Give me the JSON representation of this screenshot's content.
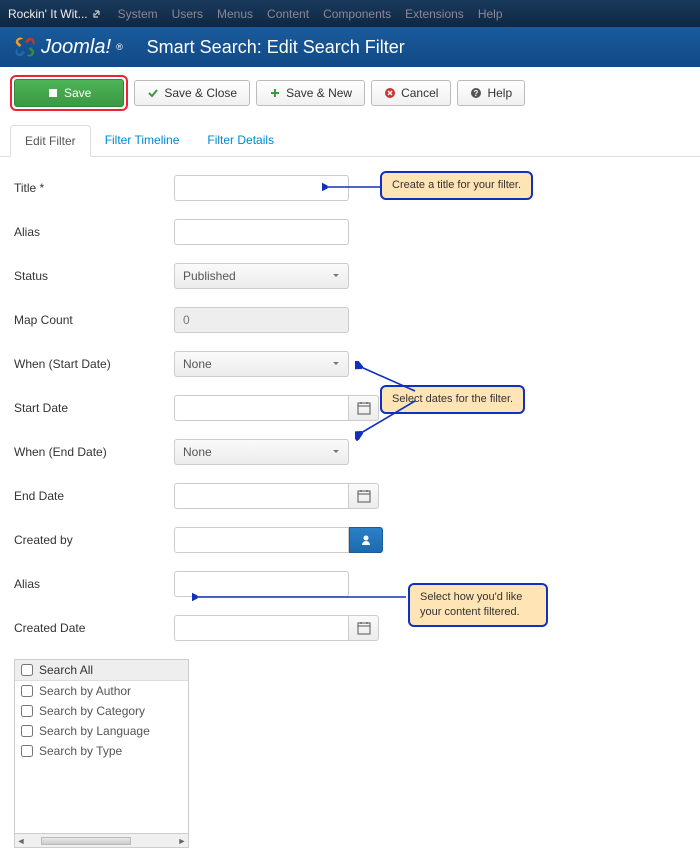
{
  "topbar": {
    "site": "Rockin' It Wit...",
    "menus": [
      "System",
      "Users",
      "Menus",
      "Content",
      "Components",
      "Extensions",
      "Help"
    ]
  },
  "header": {
    "logo_text": "Joomla!",
    "page_title": "Smart Search: Edit Search Filter"
  },
  "toolbar": {
    "save": "Save",
    "save_close": "Save & Close",
    "save_new": "Save & New",
    "cancel": "Cancel",
    "help": "Help"
  },
  "tabs": {
    "edit_filter": "Edit Filter",
    "filter_timeline": "Filter Timeline",
    "filter_details": "Filter Details"
  },
  "form": {
    "title_label": "Title *",
    "alias_label": "Alias",
    "status_label": "Status",
    "status_value": "Published",
    "map_count_label": "Map Count",
    "map_count_value": "0",
    "when_start_label": "When (Start Date)",
    "when_start_value": "None",
    "start_date_label": "Start Date",
    "when_end_label": "When (End Date)",
    "when_end_value": "None",
    "end_date_label": "End Date",
    "created_by_label": "Created by",
    "alias2_label": "Alias",
    "created_date_label": "Created Date"
  },
  "filter_box": {
    "search_all": "Search All",
    "by_author": "Search by Author",
    "by_category": "Search by Category",
    "by_language": "Search by Language",
    "by_type": "Search by Type"
  },
  "callouts": {
    "c1": "Create a title for your filter.",
    "c2": "Select dates for the filter.",
    "c3": "Select how you'd like your content filtered."
  }
}
